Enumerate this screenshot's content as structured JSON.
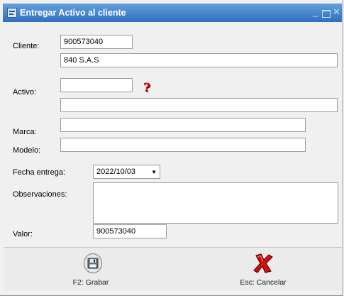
{
  "window": {
    "title": "Entregar Activo al cliente"
  },
  "form": {
    "cliente_label": "Cliente:",
    "cliente_code": "900573040",
    "cliente_name": "840 S.A.S",
    "activo_label": "Activo:",
    "activo_code": "",
    "activo_desc": "",
    "marca_label": "Marca:",
    "marca_value": "",
    "modelo_label": "Modelo:",
    "modelo_value": "",
    "fecha_label": "Fecha entrega:",
    "fecha_value": "2022/10/03",
    "observaciones_label": "Observaciones:",
    "observaciones_value": "",
    "valor_label": "Valor:",
    "valor_value": "900573040"
  },
  "footer": {
    "save_label": "F2: Grabar",
    "cancel_label": "Esc: Cancelar"
  },
  "icons": {
    "title": "app-icon",
    "help": "question-mark-icon",
    "save": "floppy-disk-icon",
    "cancel": "red-x-icon"
  },
  "colors": {
    "titlebar": "#2f6fbe",
    "help": "#cc0000",
    "cancel": "#d01010"
  }
}
